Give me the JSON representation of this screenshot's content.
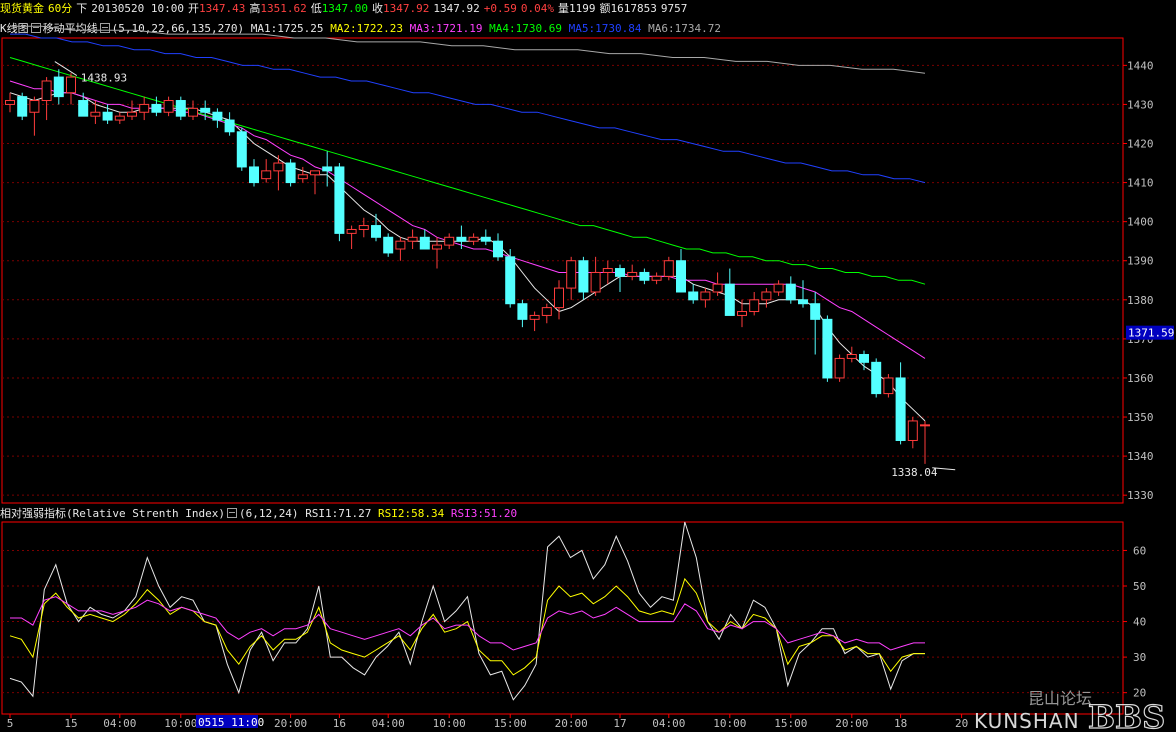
{
  "header": {
    "symbol": "现货黄金",
    "period": "60分",
    "arrow": "下",
    "datetime": "20130520 10:00",
    "open_label": "开",
    "open": "1347.43",
    "high_label": "高",
    "high": "1351.62",
    "low_label": "低",
    "low": "1347.00",
    "close_label": "收",
    "close": "1347.92",
    "last": "1347.92",
    "change": "+0.59",
    "change_pct": "0.04%",
    "volume_label": "量",
    "volume": "1199",
    "amount_label": "额",
    "amount": "1617853",
    "extra": "9757"
  },
  "ma_legend": {
    "kline_label": "K线图",
    "ma_name": "移动平均线",
    "params": "(5,10,22,66,135,270)",
    "items": [
      {
        "label": "MA1:1725.25",
        "color": "#e8e8e8"
      },
      {
        "label": "MA2:1722.23",
        "color": "#ffff00"
      },
      {
        "label": "MA3:1721.19",
        "color": "#ff40ff"
      },
      {
        "label": "MA4:1730.69",
        "color": "#00ff00"
      },
      {
        "label": "MA5:1730.84",
        "color": "#2040ff"
      },
      {
        "label": "MA6:1734.72",
        "color": "#a8a8a8"
      }
    ]
  },
  "rsi_legend": {
    "name": "相对强弱指标(Relative Strenth Index)",
    "params": "(6,12,24)",
    "items": [
      {
        "label": "RSI1:71.27",
        "color": "#e8e8e8"
      },
      {
        "label": "RSI2:58.34",
        "color": "#ffff00"
      },
      {
        "label": "RSI3:51.20",
        "color": "#ff40ff"
      }
    ]
  },
  "price_marker": "1371.59",
  "cursor_label": "0515 11:00",
  "watermark": {
    "cn": "昆山论坛",
    "en": "KUNSHAN",
    "bbs": "BBS"
  },
  "colors": {
    "up": "#ff3c3c",
    "down": "#54ffff",
    "grid": "#7a0000",
    "axis": "#ff0000"
  },
  "chart_data": [
    {
      "type": "candlestick",
      "y_ticks": [
        1330,
        1340,
        1350,
        1360,
        1370,
        1380,
        1390,
        1400,
        1410,
        1420,
        1430,
        1440
      ],
      "ylim": [
        1328,
        1447
      ],
      "annotations": [
        {
          "text": "1438.93",
          "value": 1438.93,
          "index": 4
        },
        {
          "text": "1338.04",
          "value": 1338.04,
          "index": 76
        }
      ],
      "x_ticks": [
        {
          "index": 0,
          "label": "5"
        },
        {
          "index": 5,
          "label": "15"
        },
        {
          "index": 9,
          "label": "04:00"
        },
        {
          "index": 14,
          "label": "10:00"
        },
        {
          "index": 23,
          "label": "20:00"
        },
        {
          "index": 27,
          "label": "16"
        },
        {
          "index": 31,
          "label": "04:00"
        },
        {
          "index": 36,
          "label": "10:00"
        },
        {
          "index": 41,
          "label": "15:00"
        },
        {
          "index": 46,
          "label": "20:00"
        },
        {
          "index": 50,
          "label": "17"
        },
        {
          "index": 54,
          "label": "04:00"
        },
        {
          "index": 59,
          "label": "10:00"
        },
        {
          "index": 64,
          "label": "15:00"
        },
        {
          "index": 69,
          "label": "20:00"
        },
        {
          "index": 73,
          "label": "18"
        },
        {
          "index": 78,
          "label": "20"
        }
      ],
      "ohlc": [
        [
          1430,
          1433,
          1428,
          1431
        ],
        [
          1432,
          1433,
          1426,
          1427
        ],
        [
          1428,
          1432,
          1422,
          1431
        ],
        [
          1431,
          1437,
          1426,
          1436
        ],
        [
          1437,
          1439,
          1430,
          1432
        ],
        [
          1433,
          1438,
          1430,
          1437
        ],
        [
          1431,
          1433,
          1427,
          1427
        ],
        [
          1427,
          1431,
          1425,
          1428
        ],
        [
          1428,
          1430,
          1425,
          1426
        ],
        [
          1426,
          1428,
          1425,
          1427
        ],
        [
          1427,
          1431,
          1426,
          1428
        ],
        [
          1428,
          1432,
          1426,
          1430
        ],
        [
          1430,
          1432,
          1427,
          1428
        ],
        [
          1428,
          1432,
          1427,
          1431
        ],
        [
          1431,
          1432,
          1426,
          1427
        ],
        [
          1427,
          1431,
          1426,
          1429
        ],
        [
          1429,
          1431,
          1426,
          1428
        ],
        [
          1428,
          1429,
          1424,
          1426
        ],
        [
          1426,
          1428,
          1422,
          1423
        ],
        [
          1423,
          1424,
          1413,
          1414
        ],
        [
          1414,
          1416,
          1409,
          1410
        ],
        [
          1411,
          1416,
          1410,
          1413
        ],
        [
          1413,
          1417,
          1408,
          1415
        ],
        [
          1415,
          1416,
          1409,
          1410
        ],
        [
          1411,
          1414,
          1410,
          1412
        ],
        [
          1412,
          1413,
          1407,
          1413
        ],
        [
          1414,
          1418,
          1409,
          1413
        ],
        [
          1414,
          1415,
          1395,
          1397
        ],
        [
          1397,
          1399,
          1393,
          1398
        ],
        [
          1398,
          1401,
          1396,
          1399
        ],
        [
          1399,
          1402,
          1395,
          1396
        ],
        [
          1396,
          1397,
          1391,
          1392
        ],
        [
          1393,
          1396,
          1390,
          1395
        ],
        [
          1395,
          1398,
          1393,
          1396
        ],
        [
          1396,
          1398,
          1393,
          1393
        ],
        [
          1393,
          1396,
          1388,
          1394
        ],
        [
          1394,
          1397,
          1393,
          1396
        ],
        [
          1396,
          1399,
          1393,
          1395
        ],
        [
          1395,
          1397,
          1394,
          1396
        ],
        [
          1396,
          1398,
          1394,
          1395
        ],
        [
          1395,
          1397,
          1390,
          1391
        ],
        [
          1391,
          1393,
          1378,
          1379
        ],
        [
          1379,
          1380,
          1373,
          1375
        ],
        [
          1375,
          1377,
          1372,
          1376
        ],
        [
          1376,
          1379,
          1374,
          1378
        ],
        [
          1378,
          1385,
          1375,
          1383
        ],
        [
          1383,
          1391,
          1380,
          1390
        ],
        [
          1390,
          1391,
          1380,
          1382
        ],
        [
          1382,
          1391,
          1381,
          1387
        ],
        [
          1387,
          1390,
          1384,
          1388
        ],
        [
          1388,
          1389,
          1382,
          1386
        ],
        [
          1386,
          1389,
          1385,
          1387
        ],
        [
          1387,
          1388,
          1384,
          1385
        ],
        [
          1385,
          1387,
          1384,
          1386
        ],
        [
          1386,
          1391,
          1385,
          1390
        ],
        [
          1390,
          1393,
          1382,
          1382
        ],
        [
          1382,
          1384,
          1379,
          1380
        ],
        [
          1380,
          1383,
          1378,
          1382
        ],
        [
          1382,
          1387,
          1381,
          1384
        ],
        [
          1384,
          1388,
          1376,
          1376
        ],
        [
          1376,
          1380,
          1373,
          1377
        ],
        [
          1377,
          1382,
          1376,
          1380
        ],
        [
          1380,
          1383,
          1378,
          1382
        ],
        [
          1382,
          1385,
          1381,
          1384
        ],
        [
          1384,
          1386,
          1379,
          1380
        ],
        [
          1380,
          1385,
          1378,
          1379
        ],
        [
          1379,
          1382,
          1366,
          1375
        ],
        [
          1375,
          1376,
          1359,
          1360
        ],
        [
          1360,
          1366,
          1359,
          1365
        ],
        [
          1365,
          1368,
          1364,
          1366
        ],
        [
          1366,
          1367,
          1362,
          1364
        ],
        [
          1364,
          1365,
          1355,
          1356
        ],
        [
          1356,
          1361,
          1355,
          1360
        ],
        [
          1360,
          1364,
          1343,
          1344
        ],
        [
          1344,
          1350,
          1342,
          1349
        ],
        [
          1348,
          1349,
          1338,
          1348
        ]
      ],
      "ma_lines": {
        "MA1": [
          1433,
          1432,
          1431,
          1432,
          1433,
          1433,
          1432,
          1430,
          1429,
          1428,
          1428,
          1429,
          1429,
          1429,
          1429,
          1429,
          1428,
          1427,
          1426,
          1423,
          1420,
          1418,
          1416,
          1414,
          1413,
          1412,
          1412,
          1409,
          1406,
          1403,
          1401,
          1398,
          1396,
          1395,
          1395,
          1395,
          1395,
          1395,
          1395,
          1396,
          1394,
          1391,
          1387,
          1383,
          1380,
          1377,
          1378,
          1380,
          1382,
          1384,
          1386,
          1386,
          1386,
          1386,
          1386,
          1386,
          1384,
          1383,
          1382,
          1381,
          1379,
          1379,
          1379,
          1380,
          1380,
          1380,
          1378,
          1373,
          1369,
          1366,
          1363,
          1361,
          1359,
          1355,
          1352,
          1349
        ],
        "MA3": [
          1436,
          1435,
          1434,
          1434,
          1433,
          1433,
          1432,
          1431,
          1430,
          1430,
          1429,
          1429,
          1429,
          1429,
          1428,
          1428,
          1427,
          1426,
          1425,
          1424,
          1422,
          1421,
          1419,
          1417,
          1416,
          1414,
          1413,
          1411,
          1409,
          1407,
          1405,
          1403,
          1401,
          1399,
          1398,
          1396,
          1395,
          1394,
          1393,
          1393,
          1392,
          1391,
          1390,
          1389,
          1388,
          1387,
          1387,
          1387,
          1387,
          1387,
          1387,
          1386,
          1386,
          1386,
          1386,
          1385,
          1385,
          1385,
          1384,
          1384,
          1384,
          1384,
          1384,
          1384,
          1384,
          1383,
          1382,
          1380,
          1378,
          1377,
          1375,
          1373,
          1371,
          1369,
          1367,
          1365
        ],
        "MA4": [
          1442,
          1441,
          1440,
          1439,
          1438,
          1437,
          1436,
          1435,
          1434,
          1433,
          1432,
          1431,
          1430,
          1429,
          1428,
          1427,
          1426,
          1425,
          1424,
          1423,
          1422,
          1421,
          1420,
          1419,
          1418,
          1417,
          1416,
          1415,
          1414,
          1413,
          1412,
          1411,
          1410,
          1409,
          1408,
          1407,
          1406,
          1405,
          1404,
          1403,
          1402,
          1401,
          1400,
          1399,
          1399,
          1398,
          1397,
          1396,
          1396,
          1395,
          1394,
          1393,
          1393,
          1392,
          1392,
          1391,
          1391,
          1390,
          1390,
          1389,
          1389,
          1388,
          1388,
          1387,
          1387,
          1386,
          1386,
          1385,
          1385,
          1384
        ],
        "MA5": [
          1448,
          1448,
          1447,
          1447,
          1446,
          1446,
          1445,
          1445,
          1444,
          1444,
          1443,
          1443,
          1442,
          1442,
          1441,
          1440,
          1440,
          1439,
          1439,
          1438,
          1437,
          1437,
          1436,
          1436,
          1435,
          1434,
          1433,
          1433,
          1432,
          1431,
          1430,
          1430,
          1429,
          1428,
          1428,
          1427,
          1426,
          1425,
          1424,
          1424,
          1423,
          1422,
          1421,
          1421,
          1420,
          1419,
          1418,
          1418,
          1417,
          1416,
          1415,
          1415,
          1414,
          1413,
          1413,
          1412,
          1412,
          1411,
          1411,
          1410
        ],
        "MA6": [
          1450,
          1450,
          1449,
          1449,
          1449,
          1448,
          1448,
          1448,
          1448,
          1447,
          1447,
          1446,
          1446,
          1446,
          1445,
          1445,
          1444,
          1444,
          1444,
          1443,
          1443,
          1442,
          1442,
          1441,
          1441,
          1440,
          1440,
          1439,
          1439,
          1438
        ]
      }
    },
    {
      "type": "line",
      "y_ticks": [
        20,
        30,
        40,
        50,
        60
      ],
      "ylim": [
        14,
        68
      ],
      "series": [
        {
          "name": "RSI1",
          "color": "#e8e8e8",
          "values": [
            24,
            23,
            19,
            49,
            56,
            45,
            40,
            44,
            42,
            41,
            43,
            47,
            58,
            50,
            44,
            47,
            46,
            40,
            39,
            28,
            20,
            32,
            37,
            29,
            34,
            34,
            38,
            50,
            30,
            30,
            27,
            25,
            30,
            33,
            37,
            28,
            40,
            50,
            40,
            43,
            47,
            31,
            25,
            26,
            18,
            22,
            28,
            61,
            64,
            58,
            60,
            52,
            56,
            64,
            57,
            48,
            44,
            47,
            46,
            68,
            58,
            40,
            35,
            42,
            38,
            46,
            44,
            38,
            22,
            31,
            34,
            38,
            38,
            31,
            33,
            30,
            31,
            21,
            29,
            31,
            31
          ]
        },
        {
          "name": "RSI2",
          "color": "#ffff00",
          "values": [
            36,
            35,
            30,
            45,
            48,
            44,
            41,
            42,
            41,
            40,
            42,
            45,
            49,
            46,
            42,
            44,
            43,
            40,
            39,
            32,
            28,
            33,
            36,
            32,
            35,
            35,
            37,
            44,
            34,
            32,
            31,
            30,
            32,
            34,
            36,
            32,
            38,
            42,
            37,
            38,
            40,
            32,
            29,
            29,
            25,
            27,
            30,
            46,
            50,
            47,
            48,
            45,
            47,
            50,
            47,
            43,
            42,
            43,
            42,
            52,
            48,
            40,
            37,
            40,
            38,
            42,
            41,
            38,
            28,
            33,
            34,
            36,
            36,
            32,
            33,
            31,
            31,
            26,
            30,
            31,
            31
          ]
        },
        {
          "name": "RSI3",
          "color": "#ff40ff",
          "values": [
            41,
            41,
            39,
            46,
            47,
            45,
            43,
            43,
            43,
            42,
            43,
            44,
            46,
            45,
            43,
            44,
            43,
            42,
            41,
            37,
            35,
            37,
            38,
            36,
            38,
            38,
            39,
            42,
            38,
            37,
            36,
            35,
            36,
            37,
            38,
            36,
            39,
            41,
            38,
            39,
            39,
            36,
            34,
            34,
            32,
            33,
            34,
            41,
            43,
            42,
            43,
            41,
            42,
            44,
            42,
            40,
            40,
            40,
            40,
            45,
            43,
            38,
            37,
            39,
            38,
            40,
            40,
            38,
            34,
            35,
            36,
            37,
            36,
            34,
            35,
            34,
            34,
            32,
            33,
            34,
            34
          ]
        }
      ]
    }
  ]
}
